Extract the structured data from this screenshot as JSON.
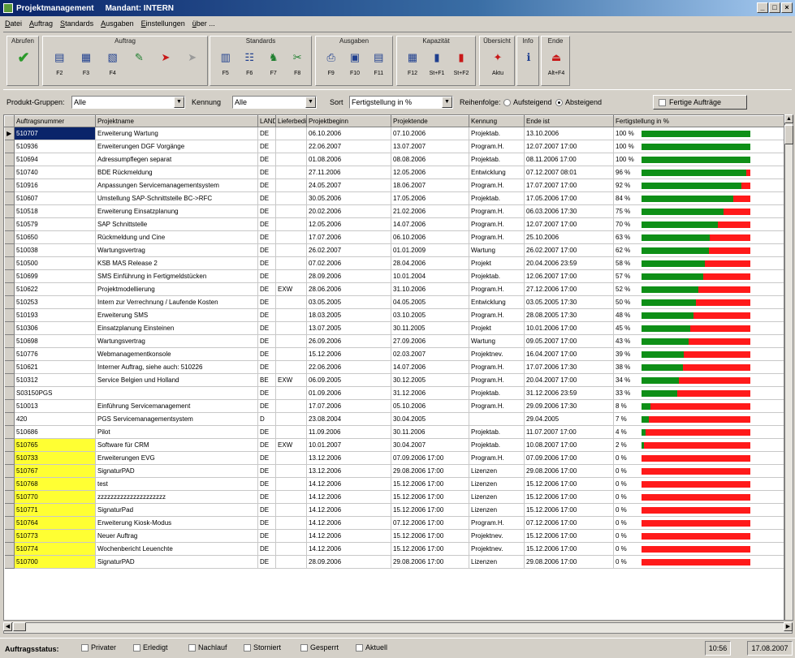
{
  "window": {
    "title": "Projektmanagement",
    "mandant": "Mandant: INTERN",
    "controls": [
      "_",
      "□",
      "×"
    ]
  },
  "menu": [
    "Datei",
    "Auftrag",
    "Standards",
    "Ausgaben",
    "Einstellungen",
    "über ..."
  ],
  "toolbar": {
    "groups": [
      {
        "label": "Abrufen",
        "buttons": [
          {
            "icon": "check-icon",
            "glyph": "✔",
            "key": ""
          }
        ]
      },
      {
        "label": "Auftrag",
        "buttons": [
          {
            "icon": "new-order-icon",
            "glyph": "▤",
            "key": "F2"
          },
          {
            "icon": "edit-order-icon",
            "glyph": "▦",
            "key": "F3"
          },
          {
            "icon": "copy-order-icon",
            "glyph": "▧",
            "key": "F4"
          },
          {
            "icon": "assign-icon",
            "glyph": "✎",
            "key": ""
          },
          {
            "icon": "mark-icon",
            "glyph": "➤",
            "key": ""
          },
          {
            "icon": "disabled-icon",
            "glyph": "➤",
            "key": ""
          }
        ]
      },
      {
        "label": "Standards",
        "buttons": [
          {
            "icon": "projects-icon",
            "glyph": "▥",
            "key": "F5"
          },
          {
            "icon": "customers-icon",
            "glyph": "☷",
            "key": "F6"
          },
          {
            "icon": "staff-icon",
            "glyph": "♞",
            "key": "F7"
          },
          {
            "icon": "tools-icon",
            "glyph": "✂",
            "key": "F8"
          }
        ]
      },
      {
        "label": "Ausgaben",
        "buttons": [
          {
            "icon": "print-icon",
            "glyph": "⎙",
            "key": "F9"
          },
          {
            "icon": "report-icon",
            "glyph": "▣",
            "key": "F10"
          },
          {
            "icon": "export-icon",
            "glyph": "▤",
            "key": "F11"
          }
        ]
      },
      {
        "label": "Kapazität",
        "buttons": [
          {
            "icon": "capacity-icon",
            "glyph": "▦",
            "key": "F12"
          },
          {
            "icon": "capacity-chart-icon",
            "glyph": "▮",
            "key": "St+F1"
          },
          {
            "icon": "capacity-chart2-icon",
            "glyph": "▮",
            "key": "St+F2"
          }
        ]
      },
      {
        "label": "Übersicht",
        "buttons": [
          {
            "icon": "overview-icon",
            "glyph": "✦",
            "key": "Aktu"
          }
        ]
      },
      {
        "label": "Info",
        "buttons": [
          {
            "icon": "info-icon",
            "glyph": "ℹ",
            "key": ""
          }
        ]
      },
      {
        "label": "Ende",
        "buttons": [
          {
            "icon": "exit-icon",
            "glyph": "⏏",
            "key": "Alt+F4"
          }
        ]
      }
    ]
  },
  "filters": {
    "produkt_label": "Produkt-Gruppen:",
    "produkt_value": "Alle",
    "kennung_label": "Kennung",
    "kennung_value": "Alle",
    "sort_label": "Sort",
    "sort_value": "Fertigstellung in %",
    "reihenfolge_label": "Reihenfolge:",
    "aufsteigend_label": "Aufsteigend",
    "absteigend_label": "Absteigend",
    "fertige_label": "Fertige Aufträge"
  },
  "table": {
    "columns": [
      "Auftragsnummer",
      "Projektname",
      "LAND",
      "Lieferbeding",
      "Projektbeginn",
      "Projektende",
      "Kennung",
      "Ende ist",
      "Fertigstellung in %"
    ],
    "rows": [
      {
        "nr": "510707",
        "name": "Erweiterung Wartung",
        "land": "DE",
        "lief": "",
        "beginn": "06.10.2006",
        "ende": "07.10.2006",
        "kennung": "Projektab.",
        "ende_ist": "13.10.2006",
        "pct": 100,
        "hl": false,
        "sel": true
      },
      {
        "nr": "510936",
        "name": "Erweiterungen DGF Vorgänge",
        "land": "DE",
        "lief": "",
        "beginn": "22.06.2007",
        "ende": "13.07.2007",
        "kennung": "Program.H.",
        "ende_ist": "12.07.2007 17:00",
        "pct": 100,
        "hl": false
      },
      {
        "nr": "510694",
        "name": "Adressumpflegen separat",
        "land": "DE",
        "lief": "",
        "beginn": "01.08.2006",
        "ende": "08.08.2006",
        "kennung": "Projektab.",
        "ende_ist": "08.11.2006 17:00",
        "pct": 100,
        "hl": false
      },
      {
        "nr": "510740",
        "name": "BDE Rückmeldung",
        "land": "DE",
        "lief": "",
        "beginn": "27.11.2006",
        "ende": "12.05.2006",
        "kennung": "Entwicklung",
        "ende_ist": "07.12.2007 08:01",
        "pct": 96,
        "hl": false
      },
      {
        "nr": "510916",
        "name": "Anpassungen Servicemanagementsystem",
        "land": "DE",
        "lief": "",
        "beginn": "24.05.2007",
        "ende": "18.06.2007",
        "kennung": "Program.H.",
        "ende_ist": "17.07.2007 17:00",
        "pct": 92,
        "hl": false
      },
      {
        "nr": "510607",
        "name": "Umstellung SAP-Schnittstelle BC->RFC",
        "land": "DE",
        "lief": "",
        "beginn": "30.05.2006",
        "ende": "17.05.2006",
        "kennung": "Projektab.",
        "ende_ist": "17.05.2006 17:00",
        "pct": 84,
        "hl": false
      },
      {
        "nr": "510518",
        "name": "Erweiterung Einsatzplanung",
        "land": "DE",
        "lief": "",
        "beginn": "20.02.2006",
        "ende": "21.02.2006",
        "kennung": "Program.H.",
        "ende_ist": "06.03.2006 17:30",
        "pct": 75,
        "hl": false
      },
      {
        "nr": "510579",
        "name": "SAP Schnittstelle",
        "land": "DE",
        "lief": "",
        "beginn": "12.05.2006",
        "ende": "14.07.2006",
        "kennung": "Program.H.",
        "ende_ist": "12.07.2007 17:00",
        "pct": 70,
        "hl": false
      },
      {
        "nr": "510650",
        "name": "Rückmeldung und Cine",
        "land": "DE",
        "lief": "",
        "beginn": "17.07.2006",
        "ende": "06.10.2006",
        "kennung": "Program.H.",
        "ende_ist": "25.10.2006",
        "pct": 63,
        "hl": false
      },
      {
        "nr": "510038",
        "name": "Wartungsvertrag",
        "land": "DE",
        "lief": "",
        "beginn": "26.02.2007",
        "ende": "01.01.2009",
        "kennung": "Wartung",
        "ende_ist": "26.02.2007 17:00",
        "pct": 62,
        "hl": false
      },
      {
        "nr": "510500",
        "name": "KSB MAS Release 2",
        "land": "DE",
        "lief": "",
        "beginn": "07.02.2006",
        "ende": "28.04.2006",
        "kennung": "Projekt",
        "ende_ist": "20.04.2006 23:59",
        "pct": 58,
        "hl": false
      },
      {
        "nr": "510699",
        "name": "SMS Einführung in Fertigmeldstücken",
        "land": "DE",
        "lief": "",
        "beginn": "28.09.2006",
        "ende": "10.01.2004",
        "kennung": "Projektab.",
        "ende_ist": "12.06.2007 17:00",
        "pct": 57,
        "hl": false
      },
      {
        "nr": "510622",
        "name": "Projektmodellierung",
        "land": "DE",
        "lief": "EXW",
        "beginn": "28.06.2006",
        "ende": "31.10.2006",
        "kennung": "Program.H.",
        "ende_ist": "27.12.2006 17:00",
        "pct": 52,
        "hl": false
      },
      {
        "nr": "510253",
        "name": "Intern zur Verrechnung / Laufende Kosten",
        "land": "DE",
        "lief": "",
        "beginn": "03.05.2005",
        "ende": "04.05.2005",
        "kennung": "Entwicklung",
        "ende_ist": "03.05.2005 17:30",
        "pct": 50,
        "hl": false
      },
      {
        "nr": "510193",
        "name": "Erweiterung SMS",
        "land": "DE",
        "lief": "",
        "beginn": "18.03.2005",
        "ende": "03.10.2005",
        "kennung": "Program.H.",
        "ende_ist": "28.08.2005 17:30",
        "pct": 48,
        "hl": false
      },
      {
        "nr": "510306",
        "name": "Einsatzplanung Einsteinen",
        "land": "DE",
        "lief": "",
        "beginn": "13.07.2005",
        "ende": "30.11.2005",
        "kennung": "Projekt",
        "ende_ist": "10.01.2006 17:00",
        "pct": 45,
        "hl": false
      },
      {
        "nr": "510698",
        "name": "Wartungsvertrag",
        "land": "DE",
        "lief": "",
        "beginn": "26.09.2006",
        "ende": "27.09.2006",
        "kennung": "Wartung",
        "ende_ist": "09.05.2007 17:00",
        "pct": 43,
        "hl": false
      },
      {
        "nr": "510776",
        "name": "Webmanagementkonsole",
        "land": "DE",
        "lief": "",
        "beginn": "15.12.2006",
        "ende": "02.03.2007",
        "kennung": "Projektnev.",
        "ende_ist": "16.04.2007 17:00",
        "pct": 39,
        "hl": false
      },
      {
        "nr": "510621",
        "name": "Interner Auftrag, siehe auch: 510226",
        "land": "DE",
        "lief": "",
        "beginn": "22.06.2006",
        "ende": "14.07.2006",
        "kennung": "Program.H.",
        "ende_ist": "17.07.2006 17:30",
        "pct": 38,
        "hl": false
      },
      {
        "nr": "510312",
        "name": "Service Belgien und Holland",
        "land": "BE",
        "lief": "EXW",
        "beginn": "06.09.2005",
        "ende": "30.12.2005",
        "kennung": "Program.H.",
        "ende_ist": "20.04.2007 17:00",
        "pct": 34,
        "hl": false
      },
      {
        "nr": "S03150PGS",
        "name": "",
        "land": "DE",
        "lief": "",
        "beginn": "01.09.2006",
        "ende": "31.12.2006",
        "kennung": "Projektab.",
        "ende_ist": "31.12.2006 23:59",
        "pct": 33,
        "hl": false
      },
      {
        "nr": "510013",
        "name": "Einführung Servicemanagement",
        "land": "DE",
        "lief": "",
        "beginn": "17.07.2006",
        "ende": "05.10.2006",
        "kennung": "Program.H.",
        "ende_ist": "29.09.2006 17:30",
        "pct": 8,
        "hl": false
      },
      {
        "nr": "420",
        "name": "PGS Servicemanagementsystem",
        "land": "D",
        "lief": "",
        "beginn": "23.08.2004",
        "ende": "30.04.2005",
        "kennung": "",
        "ende_ist": "29.04.2005",
        "pct": 7,
        "hl": false
      },
      {
        "nr": "510686",
        "name": "Pilot",
        "land": "DE",
        "lief": "",
        "beginn": "11.09.2006",
        "ende": "30.11.2006",
        "kennung": "Projektab.",
        "ende_ist": "11.07.2007 17:00",
        "pct": 4,
        "hl": false
      },
      {
        "nr": "510765",
        "name": "Software für CRM",
        "land": "DE",
        "lief": "EXW",
        "beginn": "10.01.2007",
        "ende": "30.04.2007",
        "kennung": "Projektab.",
        "ende_ist": "10.08.2007 17:00",
        "pct": 2,
        "hl": true
      },
      {
        "nr": "510733",
        "name": "Erweiterungen EVG",
        "land": "DE",
        "lief": "",
        "beginn": "13.12.2006",
        "ende": "07.09.2006 17:00",
        "kennung": "Program.H.",
        "ende_ist": "07.09.2006 17:00",
        "pct": 0,
        "hl": true
      },
      {
        "nr": "510767",
        "name": "SignaturPAD",
        "land": "DE",
        "lief": "",
        "beginn": "13.12.2006",
        "ende": "29.08.2006 17:00",
        "kennung": "Lizenzen",
        "ende_ist": "29.08.2006 17:00",
        "pct": 0,
        "hl": true
      },
      {
        "nr": "510768",
        "name": "test",
        "land": "DE",
        "lief": "",
        "beginn": "14.12.2006",
        "ende": "15.12.2006 17:00",
        "kennung": "Lizenzen",
        "ende_ist": "15.12.2006 17:00",
        "pct": 0,
        "hl": true
      },
      {
        "nr": "510770",
        "name": "zzzzzzzzzzzzzzzzzzzzz",
        "land": "DE",
        "lief": "",
        "beginn": "14.12.2006",
        "ende": "15.12.2006 17:00",
        "kennung": "Lizenzen",
        "ende_ist": "15.12.2006 17:00",
        "pct": 0,
        "hl": true
      },
      {
        "nr": "510771",
        "name": "SignaturPad",
        "land": "DE",
        "lief": "",
        "beginn": "14.12.2006",
        "ende": "15.12.2006 17:00",
        "kennung": "Lizenzen",
        "ende_ist": "15.12.2006 17:00",
        "pct": 0,
        "hl": true
      },
      {
        "nr": "510764",
        "name": "Erweiterung Kiosk-Modus",
        "land": "DE",
        "lief": "",
        "beginn": "14.12.2006",
        "ende": "07.12.2006 17:00",
        "kennung": "Program.H.",
        "ende_ist": "07.12.2006 17:00",
        "pct": 0,
        "hl": true
      },
      {
        "nr": "510773",
        "name": "Neuer Auftrag",
        "land": "DE",
        "lief": "",
        "beginn": "14.12.2006",
        "ende": "15.12.2006 17:00",
        "kennung": "Projektnev.",
        "ende_ist": "15.12.2006 17:00",
        "pct": 0,
        "hl": true
      },
      {
        "nr": "510774",
        "name": "Wochenbericht Leuenchte",
        "land": "DE",
        "lief": "",
        "beginn": "14.12.2006",
        "ende": "15.12.2006 17:00",
        "kennung": "Projektnev.",
        "ende_ist": "15.12.2006 17:00",
        "pct": 0,
        "hl": true
      },
      {
        "nr": "510700",
        "name": "SignaturPAD",
        "land": "DE",
        "lief": "",
        "beginn": "28.09.2006",
        "ende": "29.08.2006 17:00",
        "kennung": "Lizenzen",
        "ende_ist": "29.08.2006 17:00",
        "pct": 0,
        "hl": true
      }
    ]
  },
  "statusbar": {
    "label": "Auftragsstatus:",
    "items": [
      "Privater",
      "Erledigt",
      "Nachlauf",
      "Storniert",
      "Gesperrt",
      "Aktuell"
    ],
    "time": "10:56",
    "date": "17.08.2007"
  },
  "colors": {
    "done": "#0e8f17",
    "open": "#ff1a1a",
    "highlight": "#ffff33"
  }
}
